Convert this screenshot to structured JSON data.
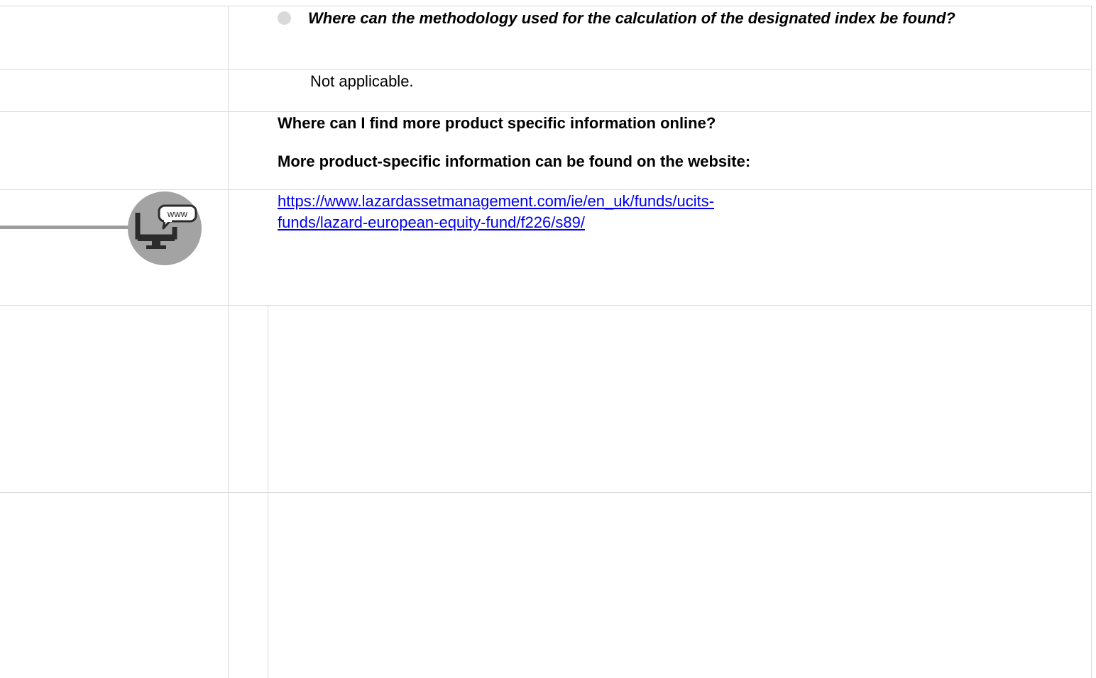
{
  "rows": {
    "methodology_question": "Where can the methodology used for the calculation of the designated index be found?",
    "methodology_answer": "Not applicable.",
    "online_question": "Where can I find more product specific information online?",
    "online_answer_intro": "More product-specific information can be found on the website:",
    "url_line1": "https://www.lazardassetmanagement.com/ie/en_uk/funds/ucits-",
    "url_line2": "funds/lazard-european-equity-fund/f226/s89/"
  },
  "icons": {
    "bullet": "circle-bullet-icon",
    "website": "computer-www-icon",
    "website_label": "www"
  },
  "colors": {
    "link": "#0000ee",
    "grid": "#d9d9d9",
    "icon_circle": "#a3a3a3",
    "icon_dark": "#2b2b2b"
  }
}
